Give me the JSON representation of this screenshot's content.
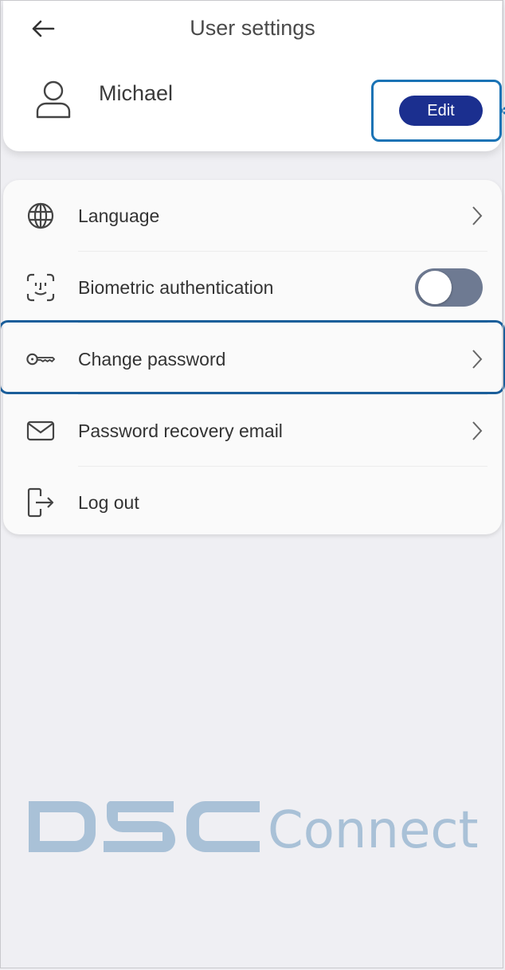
{
  "header": {
    "back_icon": "arrow-left-icon",
    "title": "User settings",
    "user_name": "Michael",
    "avatar_icon": "user-icon",
    "edit_label": "Edit"
  },
  "settings": {
    "items": [
      {
        "label": "Language",
        "icon": "globe-icon",
        "control": "chevron"
      },
      {
        "label": "Biometric authentication",
        "icon": "face-id-icon",
        "control": "toggle",
        "toggle_on": false
      },
      {
        "label": "Change password",
        "icon": "key-icon",
        "control": "chevron",
        "highlighted": true
      },
      {
        "label": "Password recovery email",
        "icon": "envelope-icon",
        "control": "chevron"
      },
      {
        "label": "Log out",
        "icon": "logout-icon",
        "control": "none"
      }
    ]
  },
  "branding": {
    "logo_mark": "DSC",
    "logo_text": "Connect",
    "logo_color": "#a9c1d7"
  },
  "colors": {
    "accent": "#1b2f8f",
    "highlight": "#1a73b5",
    "toggle_off": "#6e7a92",
    "background": "#efeff3"
  }
}
